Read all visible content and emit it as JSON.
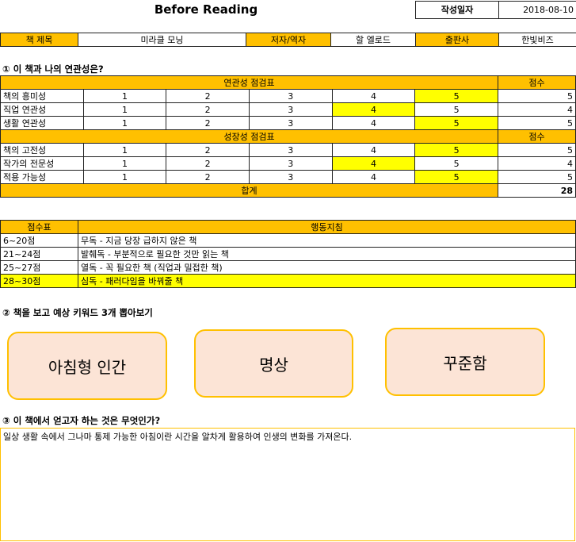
{
  "header": {
    "title": "Before Reading",
    "date_label": "작성일자",
    "date_value": "2018-08-10"
  },
  "book": {
    "title_label": "책 제목",
    "title_value": "미라클 모닝",
    "author_label": "저자/역자",
    "author_value": "할 엘로드",
    "publisher_label": "출판사",
    "publisher_value": "한빛비즈"
  },
  "section1": {
    "heading": "① 이 책과 나의 연관성은?",
    "relevance_header": "연관성 점검표",
    "score_header": "점수",
    "relevance_rows": [
      {
        "label": "책의 흥미성",
        "scale": [
          "1",
          "2",
          "3",
          "4",
          "5"
        ],
        "score": "5"
      },
      {
        "label": "직업 연관성",
        "scale": [
          "1",
          "2",
          "3",
          "4",
          "5"
        ],
        "score": "4"
      },
      {
        "label": "생활 연관성",
        "scale": [
          "1",
          "2",
          "3",
          "4",
          "5"
        ],
        "score": "5"
      }
    ],
    "growth_header": "성장성 점검표",
    "growth_score_header": "점수",
    "growth_rows": [
      {
        "label": "책의 고전성",
        "scale": [
          "1",
          "2",
          "3",
          "4",
          "5"
        ],
        "score": "5"
      },
      {
        "label": "작가의 전문성",
        "scale": [
          "1",
          "2",
          "3",
          "4",
          "5"
        ],
        "score": "4"
      },
      {
        "label": "적용 가능성",
        "scale": [
          "1",
          "2",
          "3",
          "4",
          "5"
        ],
        "score": "5"
      }
    ],
    "total_label": "합계",
    "total_value": "28"
  },
  "guide": {
    "col1": "점수표",
    "col2": "행동지침",
    "rows": [
      {
        "range": "6~20점",
        "action": "무독 - 지금 당장 급하지 않은 책"
      },
      {
        "range": "21~24점",
        "action": "발췌독 - 부분적으로 필요한 것만 읽는 책"
      },
      {
        "range": "25~27점",
        "action": "열독 - 꼭 필요한 책 (직업과 밀접한 책)"
      },
      {
        "range": "28~30점",
        "action": "심독 - 패러다임을 바꿔줄 책"
      }
    ]
  },
  "section2": {
    "heading": "② 책을 보고 예상 키워드 3개 뽑아보기",
    "keywords": [
      "아침형 인간",
      "명상",
      "꾸준함"
    ]
  },
  "section3": {
    "heading": "③ 이 책에서 얻고자 하는 것은 무엇인가?",
    "answer": "일상 생활 속에서 그나마 통제 가능한 아침이란 시간을 알차게 활용하여 인생의 변화를 가져온다."
  },
  "colors": {
    "accent": "#ffc000",
    "highlight": "#ffff00",
    "keyword_fill": "#fce4d6"
  }
}
